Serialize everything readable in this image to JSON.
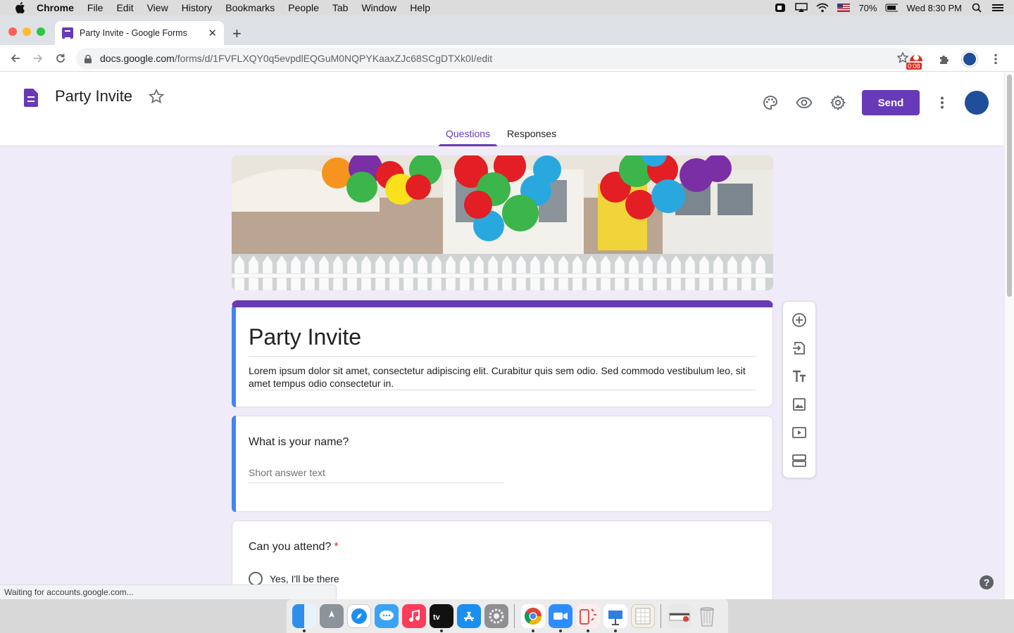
{
  "menubar": {
    "items": [
      "Chrome",
      "File",
      "Edit",
      "View",
      "History",
      "Bookmarks",
      "People",
      "Tab",
      "Window",
      "Help"
    ],
    "battery": "70%",
    "clock": "Wed 8:30 PM"
  },
  "browser": {
    "tab_title": "Party Invite - Google Forms",
    "url_domain": "docs.google.com",
    "url_path": "/forms/d/1FVFLXQY0q5evpdlEQGuM0NQPYKaaxZJc68SCgDTXk0I/edit",
    "extension_timer": "0:08",
    "status_text": "Waiting for accounts.google.com..."
  },
  "forms_header": {
    "doc_title": "Party Invite",
    "send_label": "Send",
    "tabs": [
      "Questions",
      "Responses"
    ],
    "active_tab": "Questions"
  },
  "form": {
    "title": "Party Invite",
    "description": "Lorem ipsum dolor sit amet, consectetur adipiscing elit. Curabitur quis sem odio. Sed commodo vestibulum leo, sit amet tempus odio consectetur in.",
    "questions": [
      {
        "title": "What is your name?",
        "placeholder": "Short answer text"
      },
      {
        "title": "Can you attend?",
        "required_mark": "*",
        "options": [
          "Yes,  I'll be there"
        ]
      }
    ]
  },
  "help_label": "?",
  "colors": {
    "accent": "#673ab7",
    "background": "#f0ebf8",
    "focus_bar": "#4285f4",
    "required": "#d93025"
  },
  "icons": [
    "apple-icon",
    "palette-icon",
    "preview-eye-icon",
    "settings-gear-icon",
    "more-vert-icon",
    "add-question-icon",
    "import-questions-icon",
    "add-title-icon",
    "add-image-icon",
    "add-video-icon",
    "add-section-icon"
  ]
}
